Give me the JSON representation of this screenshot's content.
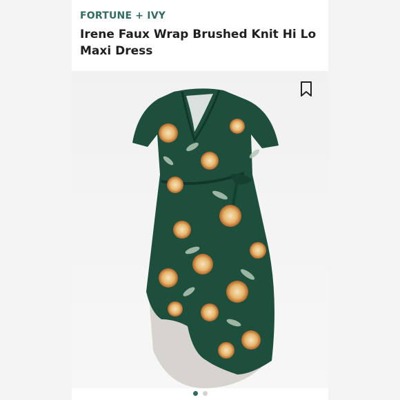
{
  "product": {
    "brand": "FORTUNE + IVY",
    "title": "Irene Faux Wrap Brushed Knit Hi Lo Maxi Dress"
  },
  "image": {
    "icon": "bookmark-icon",
    "carousel": {
      "total": 2,
      "active": 1
    }
  },
  "colors": {
    "brand": "#2f6d62",
    "dress": "#1d4f3c",
    "active_dot": "#2f6d62",
    "inactive_dot": "#d2d2d2"
  }
}
